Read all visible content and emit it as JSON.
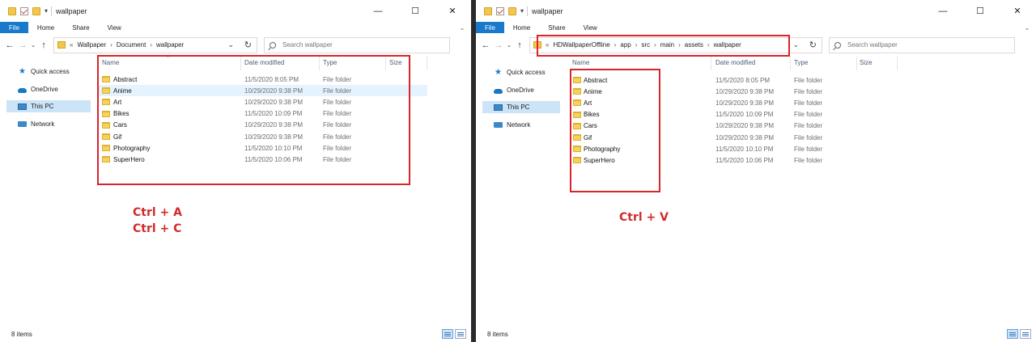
{
  "left": {
    "title": "wallpaper",
    "ribbon_tabs": [
      "File",
      "Home",
      "Share",
      "View"
    ],
    "breadcrumb": [
      "«",
      "Wallpaper",
      "›",
      "Document",
      "›",
      "wallpaper"
    ],
    "search_placeholder": "Search wallpaper",
    "sidebar": [
      "Quick access",
      "OneDrive",
      "This PC",
      "Network"
    ],
    "columns": [
      "Name",
      "Date modified",
      "Type",
      "Size"
    ],
    "rows": [
      {
        "name": "Abstract",
        "date": "11/5/2020 8:05 PM",
        "type": "File folder"
      },
      {
        "name": "Anime",
        "date": "10/29/2020 9:38 PM",
        "type": "File folder"
      },
      {
        "name": "Art",
        "date": "10/29/2020 9:38 PM",
        "type": "File folder"
      },
      {
        "name": "Bikes",
        "date": "11/5/2020 10:09 PM",
        "type": "File folder"
      },
      {
        "name": "Cars",
        "date": "10/29/2020 9:38 PM",
        "type": "File folder"
      },
      {
        "name": "Gif",
        "date": "10/29/2020 9:38 PM",
        "type": "File folder"
      },
      {
        "name": "Photography",
        "date": "11/5/2020 10:10 PM",
        "type": "File folder"
      },
      {
        "name": "SuperHero",
        "date": "11/5/2020 10:06 PM",
        "type": "File folder"
      }
    ],
    "status": "8 items",
    "hint_line1": "Ctrl + A",
    "hint_line2": "Ctrl + C"
  },
  "right": {
    "title": "wallpaper",
    "ribbon_tabs": [
      "File",
      "Home",
      "Share",
      "View"
    ],
    "breadcrumb": [
      "«",
      "HDWallpaperOffline",
      "›",
      "app",
      "›",
      "src",
      "›",
      "main",
      "›",
      "assets",
      "›",
      "wallpaper"
    ],
    "search_placeholder": "Search wallpaper",
    "sidebar": [
      "Quick access",
      "OneDrive",
      "This PC",
      "Network"
    ],
    "columns": [
      "Name",
      "Date modified",
      "Type",
      "Size"
    ],
    "rows": [
      {
        "name": "Abstract",
        "date": "11/5/2020 8:05 PM",
        "type": "File folder"
      },
      {
        "name": "Anime",
        "date": "10/29/2020 9:38 PM",
        "type": "File folder"
      },
      {
        "name": "Art",
        "date": "10/29/2020 9:38 PM",
        "type": "File folder"
      },
      {
        "name": "Bikes",
        "date": "11/5/2020 10:09 PM",
        "type": "File folder"
      },
      {
        "name": "Cars",
        "date": "10/29/2020 9:38 PM",
        "type": "File folder"
      },
      {
        "name": "Gif",
        "date": "10/29/2020 9:38 PM",
        "type": "File folder"
      },
      {
        "name": "Photography",
        "date": "11/5/2020 10:10 PM",
        "type": "File folder"
      },
      {
        "name": "SuperHero",
        "date": "11/5/2020 10:06 PM",
        "type": "File folder"
      }
    ],
    "status": "8 items",
    "hint_line1": "Ctrl + V"
  },
  "icons": {
    "back": "left-arrow-icon",
    "forward": "right-arrow-icon",
    "up": "up-arrow-icon",
    "refresh": "refresh-icon",
    "search": "search-icon",
    "folder": "folder-icon"
  },
  "colors": {
    "accent": "#1979ca",
    "selection": "#cce4f7",
    "annotation": "#d9242b"
  }
}
